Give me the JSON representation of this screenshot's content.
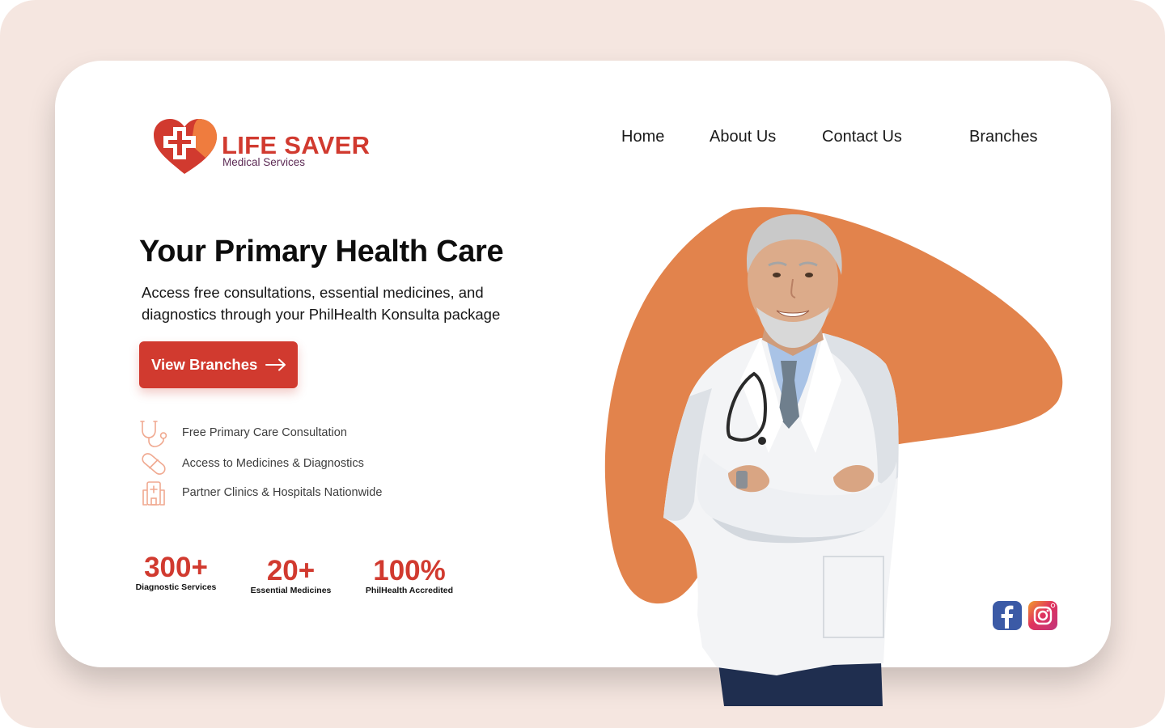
{
  "brand": {
    "title": "LIFE SAVER",
    "subtitle": "Medical Services"
  },
  "nav": {
    "items": [
      {
        "label": "Home"
      },
      {
        "label": "About Us"
      },
      {
        "label": "Contact Us"
      },
      {
        "label": "Branches"
      }
    ]
  },
  "hero": {
    "title": "Your Primary Health Care",
    "description": "Access free consultations, essential medicines, and diagnostics through your PhilHealth Konsulta package",
    "cta_label": "View Branches",
    "cta_icon": "arrow-right-icon"
  },
  "features": [
    {
      "icon": "stethoscope-icon",
      "label": "Free Primary Care Consultation"
    },
    {
      "icon": "pill-icon",
      "label": "Access to Medicines & Diagnostics"
    },
    {
      "icon": "hospital-icon",
      "label": "Partner Clinics & Hospitals Nationwide"
    }
  ],
  "stats": [
    {
      "value": "300+",
      "label": "Diagnostic Services"
    },
    {
      "value": "20+",
      "label": "Essential Medicines"
    },
    {
      "value": "100%",
      "label": "PhilHealth Accredited"
    }
  ],
  "social": [
    {
      "icon": "facebook-icon"
    },
    {
      "icon": "instagram-icon"
    }
  ],
  "colors": {
    "page_background": "#f5e6e0",
    "card_background": "#ffffff",
    "accent_red": "#d13a2f",
    "blob_orange": "#e2834c",
    "facebook_blue": "#3b5aa6"
  }
}
